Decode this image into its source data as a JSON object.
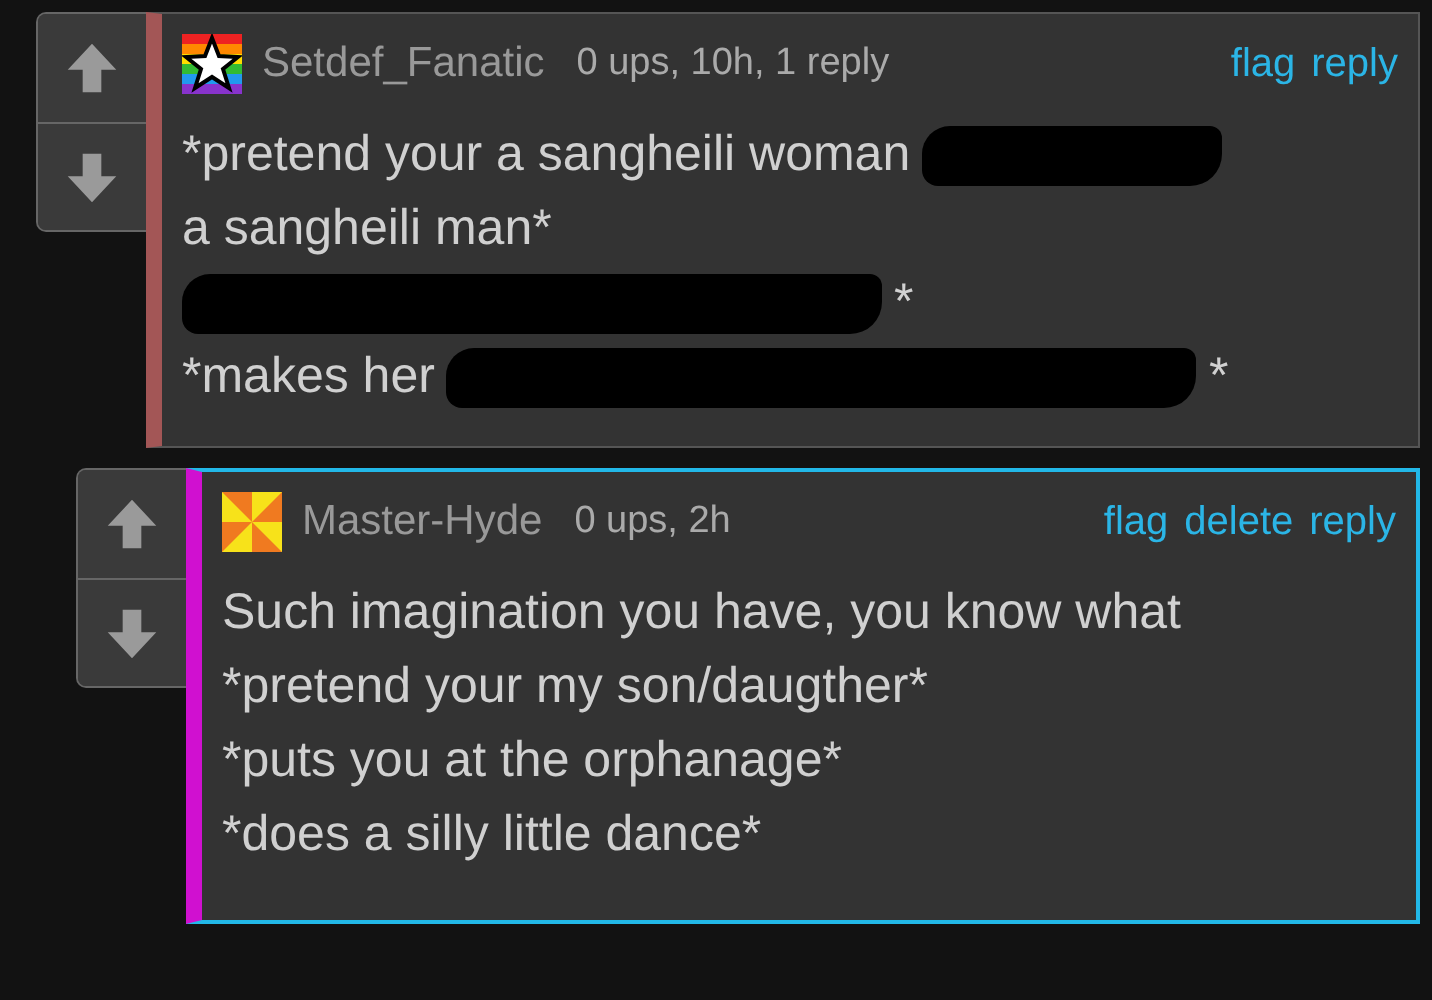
{
  "comments": [
    {
      "author": "Setdef_Fanatic",
      "kind": "starred",
      "meta": "0 ups, 10h, 1 reply",
      "color": "#a35656",
      "highlighted": false,
      "actions": [
        "flag",
        "reply"
      ],
      "body": [
        [
          {
            "kind": "text",
            "text": "*pretend your a sangheili woman"
          },
          {
            "kind": "redaction"
          }
        ],
        [
          {
            "kind": "text",
            "text": "a sangheili man*"
          }
        ],
        [
          {
            "kind": "redaction"
          },
          {
            "kind": "text",
            "text": "*"
          }
        ],
        [
          {
            "kind": "text",
            "text": "*makes her"
          },
          {
            "kind": "redaction"
          },
          {
            "kind": "text",
            "text": "*"
          }
        ]
      ]
    },
    {
      "author": "Master-Hyde",
      "kind": "pinwheel",
      "meta": "0 ups, 2h",
      "color": "#d010d0",
      "highlighted": true,
      "actions": [
        "flag",
        "delete",
        "reply"
      ],
      "body": [
        [
          {
            "kind": "text",
            "text": "Such imagination you have, you know what"
          }
        ],
        [
          {
            "kind": "text",
            "text": "*pretend your my son/daugther*"
          }
        ],
        [
          {
            "kind": "text",
            "text": "*puts you at the orphanage*"
          }
        ],
        [
          {
            "kind": "text",
            "text": "*does a silly little dance*"
          }
        ]
      ]
    }
  ]
}
